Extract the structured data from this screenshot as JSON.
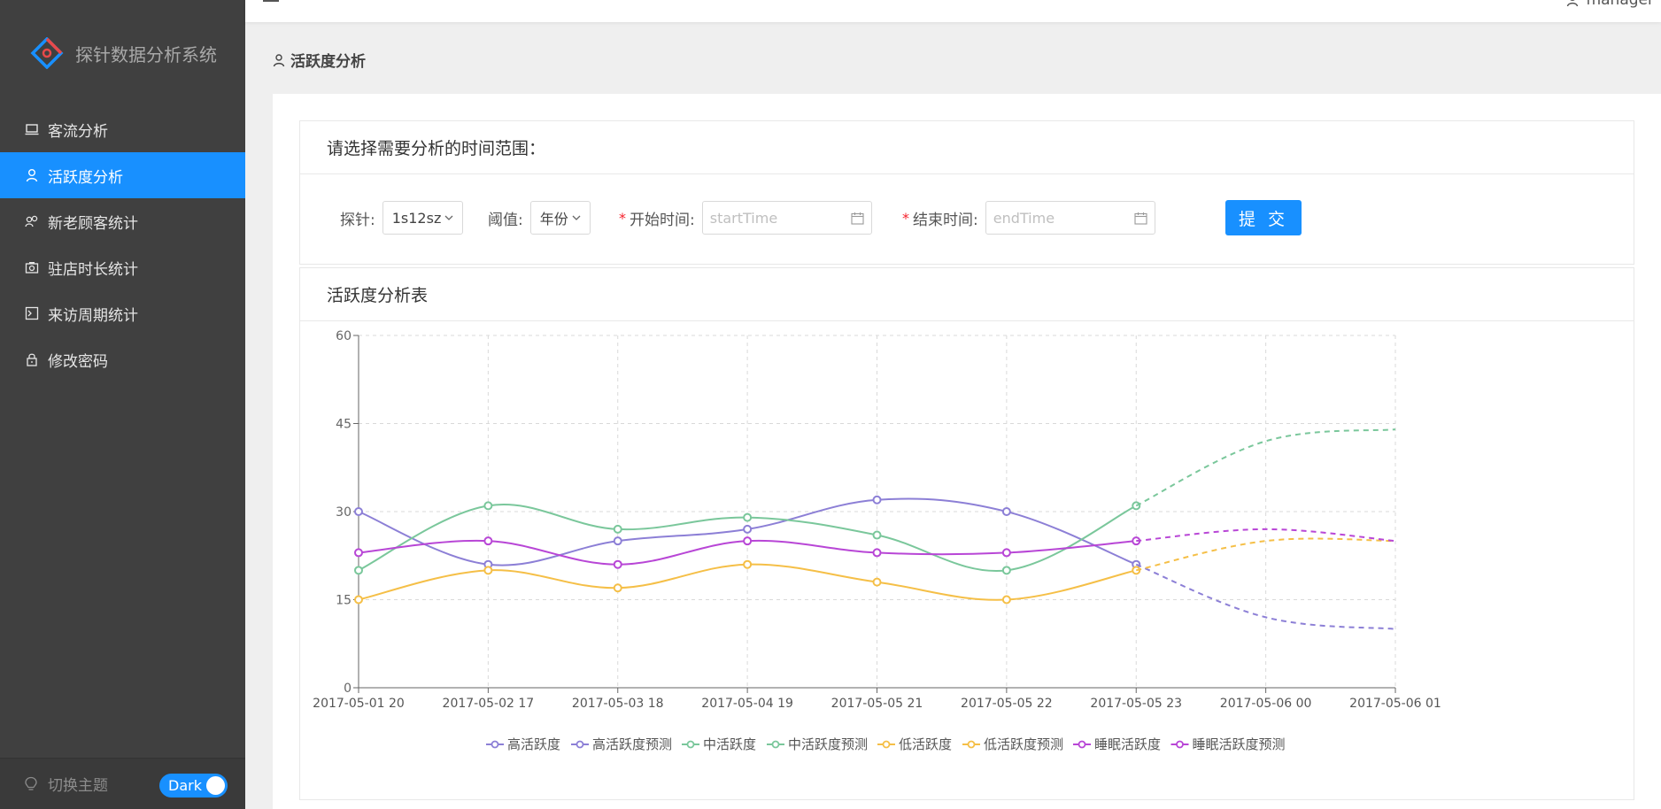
{
  "app": {
    "title": "探针数据分析系统"
  },
  "sidebar": {
    "items": [
      {
        "label": "客流分析",
        "icon": "laptop-icon"
      },
      {
        "label": "活跃度分析",
        "icon": "user-icon",
        "active": true
      },
      {
        "label": "新老顾客统计",
        "icon": "users-icon"
      },
      {
        "label": "驻店时长统计",
        "icon": "camera-icon"
      },
      {
        "label": "来访周期统计",
        "icon": "terminal-icon"
      },
      {
        "label": "修改密码",
        "icon": "lock-icon"
      }
    ],
    "theme_label": "切换主题",
    "theme_switch": "Dark"
  },
  "header": {
    "user": "manager"
  },
  "page": {
    "title": "活跃度分析"
  },
  "filter": {
    "heading": "请选择需要分析的时间范围：",
    "probe_label": "探针:",
    "probe_value": "1s12sz",
    "threshold_label": "阈值:",
    "threshold_value": "年份",
    "start_label": "开始时间:",
    "start_placeholder": "startTime",
    "end_label": "结束时间:",
    "end_placeholder": "endTime",
    "submit": "提 交"
  },
  "chart_card": {
    "heading": "活跃度分析表"
  },
  "chart_data": {
    "type": "line",
    "x": [
      "2017-05-01 20",
      "2017-05-02 17",
      "2017-05-03 18",
      "2017-05-04 19",
      "2017-05-05 21",
      "2017-05-05 22",
      "2017-05-05 23",
      "2017-05-06 00",
      "2017-05-06 01"
    ],
    "ylim": [
      0,
      60
    ],
    "yticks": [
      0,
      15,
      30,
      45,
      60
    ],
    "grid": true,
    "legend_position": "bottom",
    "series": [
      {
        "name": "高活跃度",
        "color": "#8c7fd6",
        "style": "solid",
        "values": [
          30,
          21,
          25,
          27,
          32,
          30,
          21,
          null,
          null
        ]
      },
      {
        "name": "高活跃度预测",
        "color": "#8c7fd6",
        "style": "dashed",
        "values": [
          null,
          null,
          null,
          null,
          null,
          null,
          21,
          12,
          10
        ]
      },
      {
        "name": "中活跃度",
        "color": "#7ac79b",
        "style": "solid",
        "values": [
          20,
          31,
          27,
          29,
          26,
          20,
          31,
          null,
          null
        ]
      },
      {
        "name": "中活跃度预测",
        "color": "#7ac79b",
        "style": "dashed",
        "values": [
          null,
          null,
          null,
          null,
          null,
          null,
          31,
          42,
          44
        ]
      },
      {
        "name": "低活跃度",
        "color": "#f5bf47",
        "style": "solid",
        "values": [
          15,
          20,
          17,
          21,
          18,
          15,
          20,
          null,
          null
        ]
      },
      {
        "name": "低活跃度预测",
        "color": "#f5bf47",
        "style": "dashed",
        "values": [
          null,
          null,
          null,
          null,
          null,
          null,
          20,
          25,
          25
        ]
      },
      {
        "name": "睡眠活跃度",
        "color": "#b846d6",
        "style": "solid",
        "values": [
          23,
          25,
          21,
          25,
          23,
          23,
          25,
          null,
          null
        ]
      },
      {
        "name": "睡眠活跃度预测",
        "color": "#b846d6",
        "style": "dashed",
        "values": [
          null,
          null,
          null,
          null,
          null,
          null,
          25,
          27,
          25
        ]
      }
    ]
  }
}
